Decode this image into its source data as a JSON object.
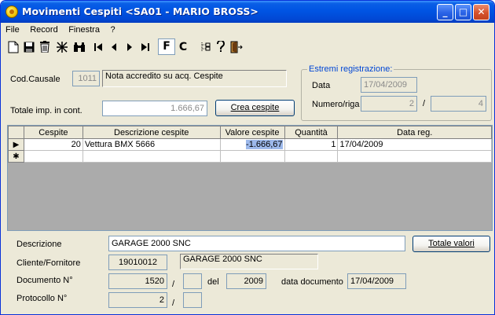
{
  "window": {
    "title": "Movimenti Cespiti <SA01 - MARIO BROSS>",
    "controls": {
      "minimize": "_",
      "maximize": "□",
      "close": "✕"
    }
  },
  "menu": [
    "File",
    "Record",
    "Finestra",
    "?"
  ],
  "toolbar": {
    "icons": [
      "new-icon",
      "save-icon",
      "delete-icon",
      "clear-icon",
      "binoculars-icon",
      "first-record-icon",
      "prev-record-icon",
      "next-record-icon",
      "last-record-icon",
      "filter-icon",
      "cancel-filter-icon",
      "tree-icon",
      "help-icon",
      "exit-icon"
    ],
    "f_label": "F",
    "c_label": "C"
  },
  "header": {
    "cod_causale_label": "Cod.Causale",
    "cod_causale_value": "1011",
    "causale_desc": "Nota accredito su acq. Cespite",
    "totale_label": "Totale imp. in cont.",
    "totale_value": "1.666,67",
    "crea_cespite_label": "Crea cespite"
  },
  "estremi": {
    "title": "Estremi registrazione:",
    "data_label": "Data",
    "data_value": "17/04/2009",
    "numero_label": "Numero/riga",
    "numero_value": "2",
    "separator": "/",
    "riga_value": "4"
  },
  "grid": {
    "columns": [
      "Cespite",
      "Descrizione cespite",
      "Valore cespite",
      "Quantità",
      "Data reg."
    ],
    "rows": [
      {
        "marker": "▶",
        "cespite": "20",
        "descrizione": "Vettura BMX 5666",
        "valore": "-1.666,67",
        "quantita": "1",
        "data_reg": "17/04/2009"
      },
      {
        "marker": "✱",
        "cespite": "",
        "descrizione": "",
        "valore": "",
        "quantita": "",
        "data_reg": ""
      }
    ]
  },
  "footer": {
    "descrizione_label": "Descrizione",
    "descrizione_value": "GARAGE 2000 SNC",
    "totale_valori_label": "Totale valori",
    "cliente_label": "Cliente/Fornitore",
    "cliente_code": "19010012",
    "cliente_name": "GARAGE 2000 SNC",
    "documento_label": "Documento N°",
    "documento_value": "1520",
    "documento_sep": "/",
    "documento_suffix": "",
    "del_label": "del",
    "documento_anno": "2009",
    "data_documento_label": "data documento",
    "data_documento_value": "17/04/2009",
    "protocollo_label": "Protocollo N°",
    "protocollo_value": "2",
    "protocollo_sep": "/",
    "protocollo_suffix": ""
  }
}
